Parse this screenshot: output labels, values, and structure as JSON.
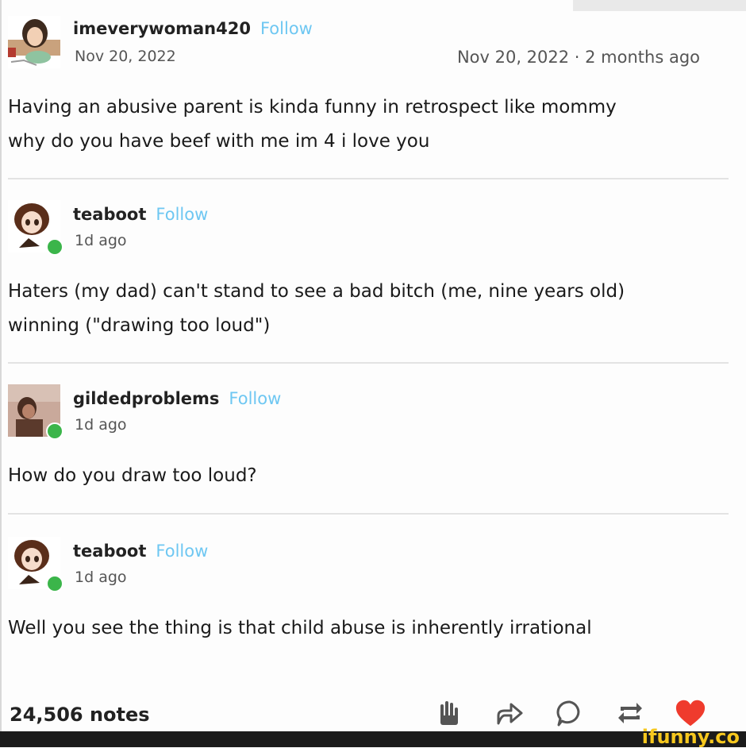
{
  "posts": [
    {
      "username": "imeverywoman420",
      "follow_label": "Follow",
      "date": "Nov 20, 2022",
      "date_right": "Nov 20, 2022 · 2 months ago",
      "text_lines": [
        "Having an abusive parent is kinda funny in retrospect like mommy",
        "why do you have beef with me im 4 i love you"
      ]
    },
    {
      "username": "teaboot",
      "follow_label": "Follow",
      "date": "1d ago",
      "text_lines": [
        "Haters (my dad) can't stand to see a bad bitch (me, nine years old)",
        "winning (\"drawing too loud\")"
      ]
    },
    {
      "username": "gildedproblems",
      "follow_label": "Follow",
      "date": "1d ago",
      "text_lines": [
        "How do you draw too loud?"
      ]
    },
    {
      "username": "teaboot",
      "follow_label": "Follow",
      "date": "1d ago",
      "text_lines": [
        "Well you see the thing is that child abuse is inherently irrational"
      ]
    }
  ],
  "footer": {
    "notes": "24,506 notes",
    "icons": [
      "hand-icon",
      "share-icon",
      "reply-icon",
      "reblog-icon",
      "heart-icon"
    ]
  },
  "watermark": "ifunny.co",
  "colors": {
    "follow": "#6ec7f2",
    "online": "#3bb54a",
    "heart": "#ef3b2d",
    "watermark": "#f7c81e"
  }
}
